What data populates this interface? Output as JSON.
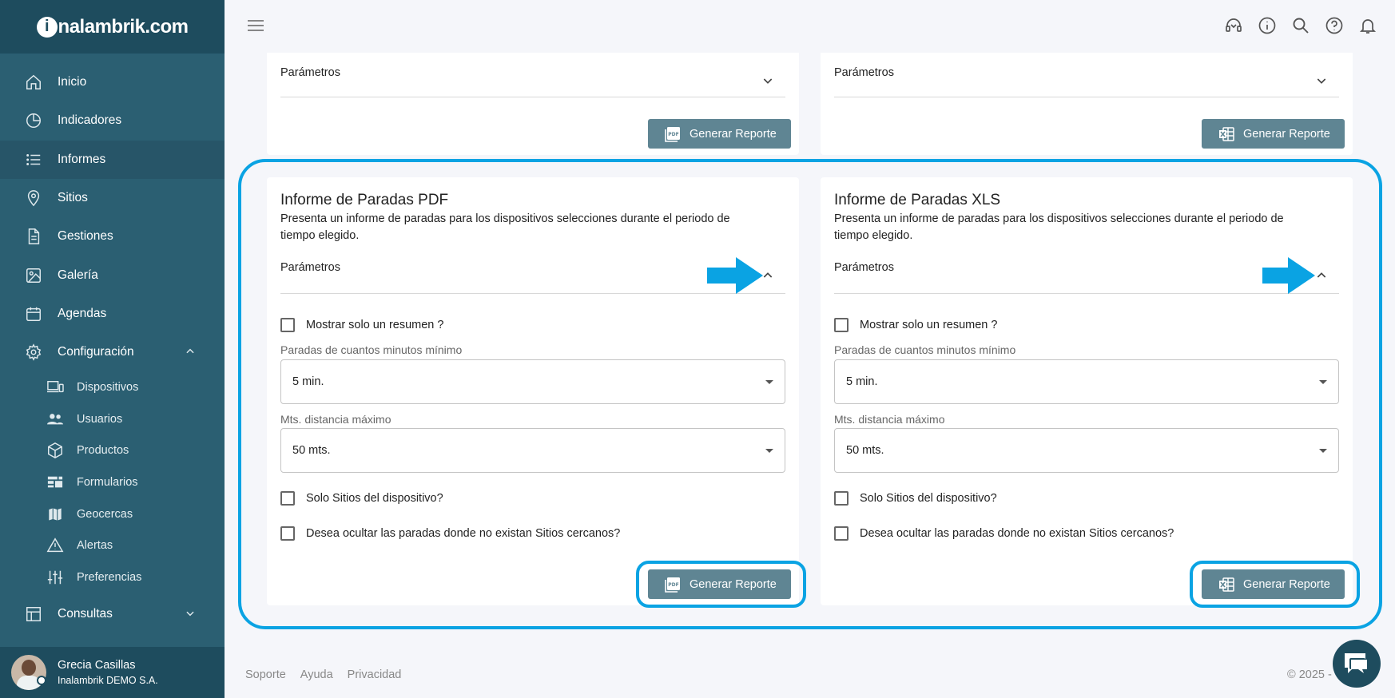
{
  "brand": {
    "logo_text": "nalambrik.com",
    "logo_letter": "i"
  },
  "sidebar": {
    "items": [
      {
        "label": "Inicio",
        "icon": "home-icon"
      },
      {
        "label": "Indicadores",
        "icon": "pie-chart-icon"
      },
      {
        "label": "Informes",
        "icon": "list-icon",
        "active": true
      },
      {
        "label": "Sitios",
        "icon": "map-pin-icon"
      },
      {
        "label": "Gestiones",
        "icon": "document-icon"
      },
      {
        "label": "Galería",
        "icon": "image-icon"
      },
      {
        "label": "Agendas",
        "icon": "calendar-icon"
      },
      {
        "label": "Configuración",
        "icon": "gear-icon",
        "expanded": true
      }
    ],
    "sub_items": [
      {
        "label": "Dispositivos",
        "icon": "devices-icon"
      },
      {
        "label": "Usuarios",
        "icon": "users-icon"
      },
      {
        "label": "Productos",
        "icon": "box-icon"
      },
      {
        "label": "Formularios",
        "icon": "form-icon"
      },
      {
        "label": "Geocercas",
        "icon": "map-icon"
      },
      {
        "label": "Alertas",
        "icon": "warning-icon"
      },
      {
        "label": "Preferencias",
        "icon": "sliders-icon"
      }
    ],
    "consultas": {
      "label": "Consultas",
      "icon": "table-icon"
    }
  },
  "user": {
    "name": "Grecia Casillas",
    "org": "Inalambrik DEMO S.A."
  },
  "top_cards": [
    {
      "params_label": "Parámetros",
      "button_label": "Generar Reporte",
      "button_icon": "pdf-icon"
    },
    {
      "params_label": "Parámetros",
      "button_label": "Generar Reporte",
      "button_icon": "xls-icon"
    }
  ],
  "reports": [
    {
      "title": "Informe de Paradas PDF",
      "desc_line1": "Presenta un informe de paradas para los dispositivos selecciones durante el periodo de",
      "desc_line2": "tiempo elegido.",
      "params_label": "Parámetros",
      "summary_label": "Mostrar solo un resumen ?",
      "min_stop_label": "Paradas de cuantos minutos mínimo",
      "min_stop_value": "5 min.",
      "distance_label": "Mts. distancia máximo",
      "distance_value": "50 mts.",
      "sites_label": "Solo Sitios del dispositivo?",
      "hide_label": "Desea ocultar las paradas donde no existan Sitios cercanos?",
      "button_label": "Generar Reporte",
      "button_icon": "pdf-icon"
    },
    {
      "title": "Informe de Paradas XLS",
      "desc_line1": "Presenta un informe de paradas para los dispositivos selecciones durante el periodo de",
      "desc_line2": "tiempo elegido.",
      "params_label": "Parámetros",
      "summary_label": "Mostrar solo un resumen ?",
      "min_stop_label": "Paradas de cuantos minutos mínimo",
      "min_stop_value": "5 min.",
      "distance_label": "Mts. distancia máximo",
      "distance_value": "50 mts.",
      "sites_label": "Solo Sitios del dispositivo?",
      "hide_label": "Desea ocultar las paradas donde no existan Sitios cercanos?",
      "button_label": "Generar Reporte",
      "button_icon": "xls-icon"
    }
  ],
  "footer": {
    "support": "Soporte",
    "help": "Ayuda",
    "privacy": "Privacidad",
    "copyright": "© 2025 -"
  },
  "colors": {
    "sidebar": "#2b5f72",
    "sidebar_dark": "#1e4c5e",
    "button": "#5f8593",
    "highlight": "#0aa3e3"
  }
}
